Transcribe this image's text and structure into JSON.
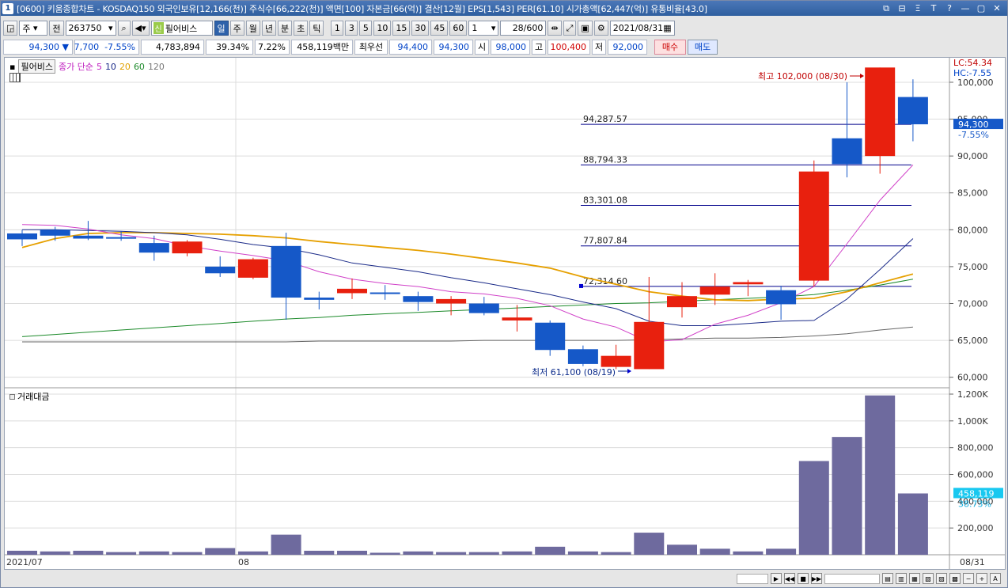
{
  "title": {
    "number": "1",
    "text": "[0600] 키움종합차트 - KOSDAQ150 외국인보유[12,166(천)] 주식수[66,222(천)] 액면[100] 자본금[66(억)] 결산[12월] EPS[1,543] PER[61.10] 시가총액[62,447(억)] 유통비율[43.0]",
    "controls": [
      "⧉",
      "⊟",
      "Ξ",
      "T",
      "?",
      "—",
      "▢",
      "✕"
    ]
  },
  "toolbar": {
    "jusik": "주",
    "jeon": "전",
    "code": "263750",
    "shinyong": "신",
    "stock_name": "필어비스",
    "periods": [
      "일",
      "주",
      "월",
      "년",
      "분",
      "초",
      "틱"
    ],
    "selected_period": "일",
    "intervals": [
      "1",
      "3",
      "5",
      "10",
      "15",
      "30",
      "45",
      "60"
    ],
    "interval_value": "1",
    "count": "28/600",
    "date": "2021/08/31"
  },
  "quote": {
    "price": "94,300",
    "arrow": "▼",
    "change": "7,700",
    "change_pct": "-7.55%",
    "volume": "4,783,894",
    "ratio1": "39.34%",
    "ratio2": "7.22%",
    "amount": "458,119백만",
    "best_label": "최우선",
    "best_ask": "94,400",
    "best_bid": "94,300",
    "open_label": "시",
    "open": "98,000",
    "high_label": "고",
    "high": "100,400",
    "low_label": "저",
    "low": "92,000",
    "buy": "매수",
    "sell": "매도"
  },
  "legend": {
    "name": "필어비스",
    "label": "종가 단순",
    "ma": [
      "5",
      "10",
      "20",
      "60",
      "120"
    ]
  },
  "price_panel": {
    "lc": "LC:54.34",
    "hc": "HC:-7.55",
    "y_ticks": [
      "100,000",
      "95,000",
      "90,000",
      "85,000",
      "80,000",
      "75,000",
      "70,000",
      "65,000",
      "60,000"
    ],
    "current_price": "94,300",
    "current_pct": "-7.55%",
    "high_annotation": "최고 102,000 (08/30)",
    "low_annotation": "최저 61,100 (08/19)",
    "fib_levels": [
      "94,287.57",
      "88,794.33",
      "83,301.08",
      "77,807.84",
      "72,314.60"
    ]
  },
  "volume_panel": {
    "label": "거래대금",
    "y_ticks": [
      "1,200K",
      "1,000K",
      "800,000",
      "600,000",
      "400,000",
      "200,000"
    ],
    "current_value": "458,119",
    "current_pct": "38.73%"
  },
  "x_labels": [
    "2021/07",
    "08",
    "08/31"
  ],
  "colors": {
    "up": "#e8200e",
    "down": "#1558c8",
    "volume": "#6e6a9e",
    "ma5": "#d040c8",
    "ma10": "#1a2a88",
    "ma20": "#e6a000",
    "ma60": "#1c8a2a",
    "ma120": "#666666",
    "fib": "#00008b"
  },
  "chart_data": {
    "type": "candlestick",
    "candles": [
      {
        "o": 79500,
        "h": 80000,
        "l": 77800,
        "c": 78700
      },
      {
        "o": 80000,
        "h": 80400,
        "l": 78500,
        "c": 79200
      },
      {
        "o": 79200,
        "h": 81200,
        "l": 78600,
        "c": 78800
      },
      {
        "o": 79000,
        "h": 79800,
        "l": 78500,
        "c": 78900
      },
      {
        "o": 78200,
        "h": 79200,
        "l": 75800,
        "c": 76900
      },
      {
        "o": 76800,
        "h": 78600,
        "l": 76400,
        "c": 78400
      },
      {
        "o": 75000,
        "h": 76400,
        "l": 73600,
        "c": 74100
      },
      {
        "o": 73500,
        "h": 76200,
        "l": 73300,
        "c": 76000
      },
      {
        "o": 77800,
        "h": 79600,
        "l": 67800,
        "c": 70800
      },
      {
        "o": 70800,
        "h": 71600,
        "l": 69200,
        "c": 70500
      },
      {
        "o": 71400,
        "h": 73400,
        "l": 70600,
        "c": 72000
      },
      {
        "o": 71500,
        "h": 72500,
        "l": 70500,
        "c": 71300
      },
      {
        "o": 71000,
        "h": 71600,
        "l": 69000,
        "c": 70200
      },
      {
        "o": 70000,
        "h": 71000,
        "l": 68400,
        "c": 70600
      },
      {
        "o": 70000,
        "h": 70900,
        "l": 68400,
        "c": 68700
      },
      {
        "o": 67700,
        "h": 69800,
        "l": 66200,
        "c": 68100
      },
      {
        "o": 67400,
        "h": 67700,
        "l": 62900,
        "c": 63700
      },
      {
        "o": 63800,
        "h": 64300,
        "l": 61500,
        "c": 61800
      },
      {
        "o": 61400,
        "h": 64400,
        "l": 61100,
        "c": 62900
      },
      {
        "o": 61100,
        "h": 73600,
        "l": 61100,
        "c": 67500
      },
      {
        "o": 69500,
        "h": 72900,
        "l": 68100,
        "c": 71000
      },
      {
        "o": 71200,
        "h": 74100,
        "l": 69800,
        "c": 72300
      },
      {
        "o": 72600,
        "h": 73200,
        "l": 71000,
        "c": 72900
      },
      {
        "o": 71800,
        "h": 72400,
        "l": 67800,
        "c": 69900
      },
      {
        "o": 73100,
        "h": 89400,
        "l": 72300,
        "c": 87900
      },
      {
        "o": 92400,
        "h": 100000,
        "l": 87100,
        "c": 88900
      },
      {
        "o": 90000,
        "h": 102000,
        "l": 87600,
        "c": 102000
      },
      {
        "o": 98000,
        "h": 100400,
        "l": 92000,
        "c": 94300
      }
    ],
    "ma5": [
      80700,
      80600,
      80100,
      79300,
      78800,
      77800,
      77100,
      76500,
      75800,
      74300,
      73300,
      72700,
      72300,
      71600,
      71300,
      70700,
      69700,
      67900,
      66800,
      64800,
      65100,
      67200,
      68400,
      70100,
      72300,
      78100,
      84000,
      88800
    ],
    "ma10": [
      80000,
      80000,
      79900,
      79800,
      79600,
      79300,
      78700,
      78000,
      77500,
      76600,
      75500,
      74900,
      74300,
      73500,
      72800,
      72000,
      71200,
      70200,
      69300,
      67600,
      67000,
      67000,
      67300,
      67600,
      67700,
      70600,
      74600,
      78800
    ],
    "ma20": [
      77600,
      78800,
      79500,
      79600,
      79600,
      79500,
      79400,
      79200,
      78900,
      78400,
      78000,
      77600,
      77200,
      76700,
      76100,
      75500,
      74800,
      73600,
      72600,
      71600,
      71000,
      70500,
      70400,
      70600,
      70700,
      71600,
      72800,
      74000
    ],
    "ma60": [
      65500,
      65800,
      66100,
      66400,
      66700,
      67000,
      67300,
      67600,
      67900,
      68100,
      68400,
      68600,
      68800,
      69000,
      69200,
      69400,
      69600,
      69800,
      70000,
      70100,
      70300,
      70500,
      70700,
      70900,
      71200,
      71800,
      72500,
      73300
    ],
    "ma120": [
      64800,
      64800,
      64800,
      64800,
      64800,
      64800,
      64800,
      64800,
      64800,
      64900,
      64900,
      64900,
      64900,
      64900,
      65000,
      65000,
      65000,
      65000,
      65000,
      65100,
      65200,
      65300,
      65300,
      65400,
      65600,
      65900,
      66400,
      66800
    ],
    "fib_values": [
      94287.57,
      88794.33,
      83301.08,
      77807.84,
      72314.6
    ],
    "amount": [
      30000,
      25000,
      30000,
      20000,
      25000,
      20000,
      50000,
      25000,
      150000,
      30000,
      30000,
      15000,
      25000,
      20000,
      20000,
      25000,
      60000,
      25000,
      20000,
      165000,
      75000,
      45000,
      25000,
      45000,
      700000,
      880000,
      1190000,
      458119
    ],
    "price_range": [
      59000,
      103000
    ],
    "amount_range": [
      0,
      1200000
    ],
    "grid": true
  }
}
